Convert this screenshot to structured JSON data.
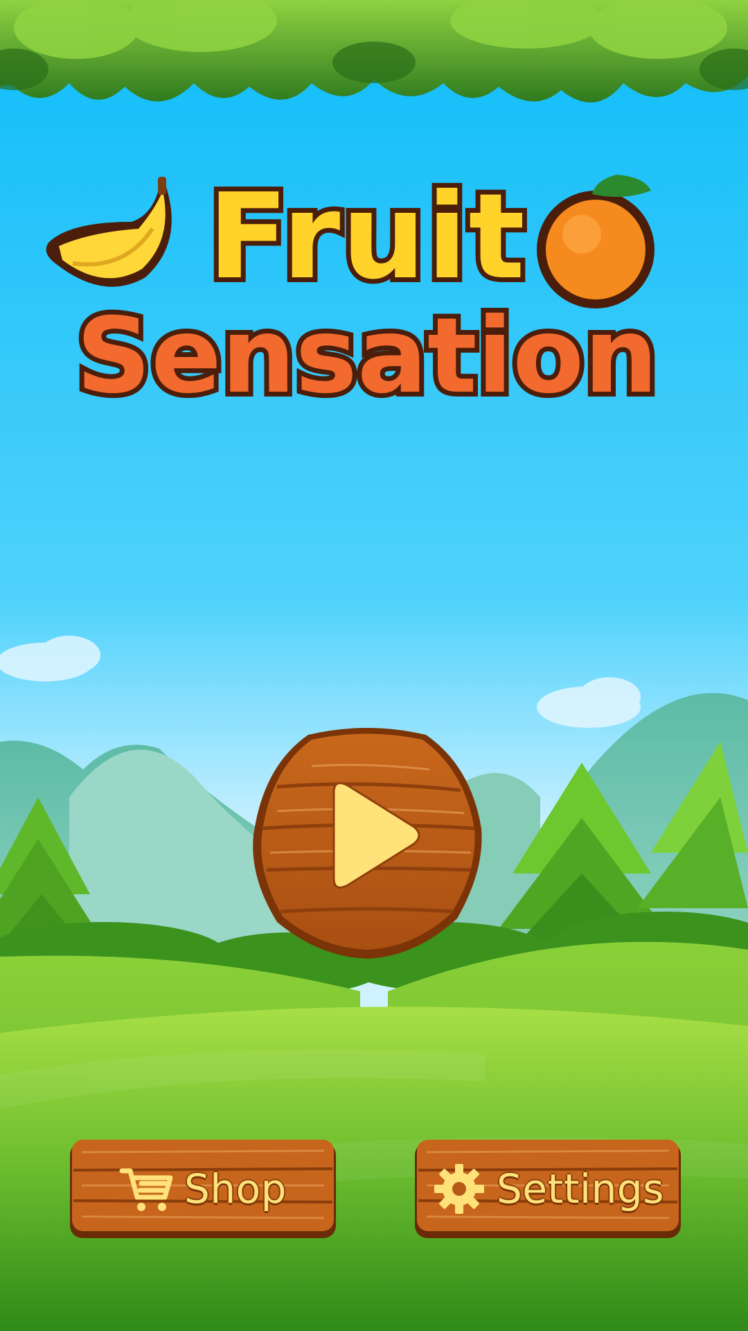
{
  "game": {
    "title_line1": "Fruit",
    "title_line2": "Sensation"
  },
  "buttons": {
    "play": {
      "icon": "play-icon"
    },
    "shop": {
      "label": "Shop",
      "icon": "cart-icon"
    },
    "settings": {
      "label": "Settings",
      "icon": "gear-icon"
    }
  },
  "colors": {
    "sky_top": "#12bdf9",
    "sky_bottom": "#c8f0ff",
    "grass_light": "#a6dd3c",
    "grass_dark": "#2f8a18",
    "wood": "#c2621a",
    "wood_dark": "#7a3408",
    "title_yellow": "#ffd32a",
    "title_orange": "#f36a2f",
    "label_cream": "#ffe27a"
  }
}
